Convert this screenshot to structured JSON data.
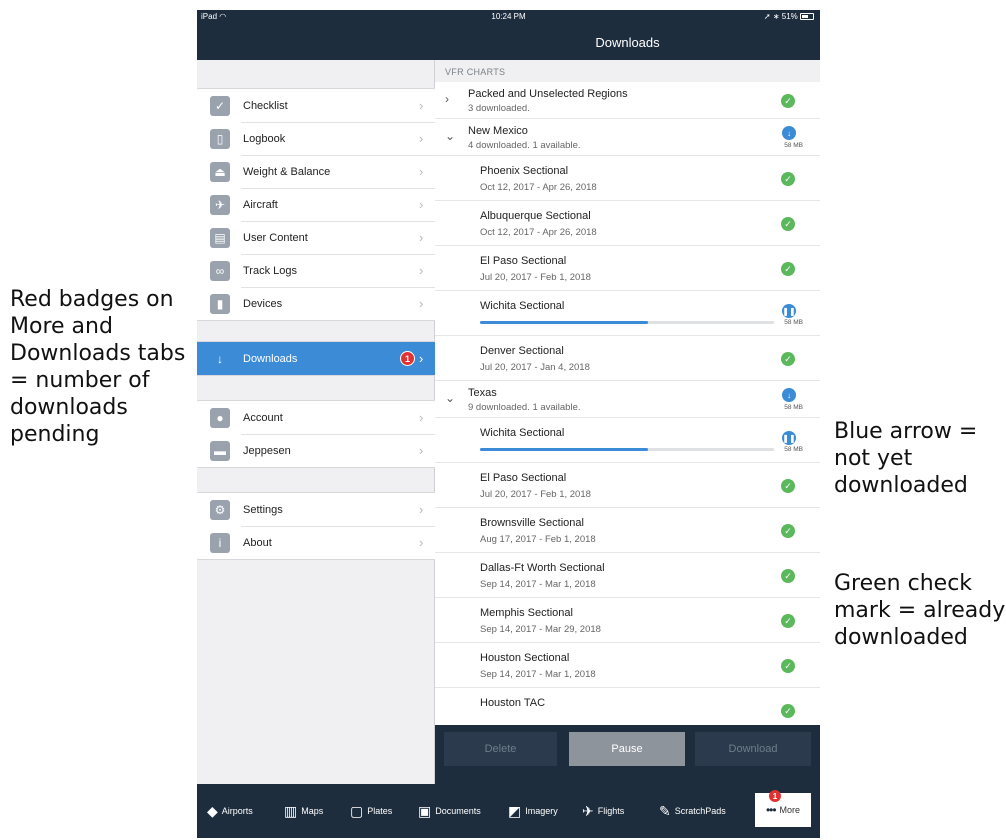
{
  "annotations": {
    "left": "Red badges on More and Downloads tabs = number of downloads pending",
    "blue_arrow": "Blue arrow = not yet downloaded",
    "green_check": "Green check mark = already downloaded"
  },
  "status_bar": {
    "device": "iPad",
    "time": "10:24 PM",
    "battery": "51%"
  },
  "nav": {
    "title": "Downloads"
  },
  "sidebar": {
    "group1": [
      {
        "label": "Checklist",
        "icon": "checklist-icon",
        "glyph": "✓"
      },
      {
        "label": "Logbook",
        "icon": "logbook-icon",
        "glyph": "▯"
      },
      {
        "label": "Weight & Balance",
        "icon": "weight-icon",
        "glyph": "⏏"
      },
      {
        "label": "Aircraft",
        "icon": "aircraft-icon",
        "glyph": "✈"
      },
      {
        "label": "User Content",
        "icon": "user-content-icon",
        "glyph": "▤"
      },
      {
        "label": "Track Logs",
        "icon": "track-logs-icon",
        "glyph": "∞"
      },
      {
        "label": "Devices",
        "icon": "devices-icon",
        "glyph": "▮"
      }
    ],
    "downloads": {
      "label": "Downloads",
      "icon": "download-arrow-icon",
      "glyph": "↓",
      "badge": "1"
    },
    "group3": [
      {
        "label": "Account",
        "icon": "account-icon",
        "glyph": "●"
      },
      {
        "label": "Jeppesen",
        "icon": "jeppesen-icon",
        "glyph": "▬"
      }
    ],
    "group4": [
      {
        "label": "Settings",
        "icon": "settings-icon",
        "glyph": "⚙"
      },
      {
        "label": "About",
        "icon": "about-icon",
        "glyph": "i"
      }
    ]
  },
  "content": {
    "section_header": "VFR CHARTS",
    "packed": {
      "title": "Packed and Unselected Regions",
      "sub": "3 downloaded."
    },
    "new_mexico": {
      "title": "New Mexico",
      "sub": "4 downloaded. 1 available.",
      "size": "58 MB",
      "charts": [
        {
          "title": "Phoenix Sectional",
          "sub": "Oct 12, 2017 - Apr 26, 2018"
        },
        {
          "title": "Albuquerque Sectional",
          "sub": "Oct 12, 2017 - Apr 26, 2018"
        },
        {
          "title": "El Paso Sectional",
          "sub": "Jul 20, 2017 - Feb 1, 2018"
        }
      ],
      "downloading": {
        "title": "Wichita Sectional",
        "size": "58 MB",
        "progress": 0.57
      },
      "charts_after": [
        {
          "title": "Denver Sectional",
          "sub": "Jul 20, 2017 - Jan 4, 2018"
        }
      ]
    },
    "texas": {
      "title": "Texas",
      "sub": "9 downloaded. 1 available.",
      "size": "58 MB",
      "downloading": {
        "title": "Wichita Sectional",
        "size": "58 MB",
        "progress": 0.57
      },
      "charts": [
        {
          "title": "El Paso Sectional",
          "sub": "Jul 20, 2017 - Feb 1, 2018"
        },
        {
          "title": "Brownsville Sectional",
          "sub": "Aug 17, 2017 - Feb 1, 2018"
        },
        {
          "title": "Dallas-Ft Worth Sectional",
          "sub": "Sep 14, 2017 - Mar 1, 2018"
        },
        {
          "title": "Memphis Sectional",
          "sub": "Sep 14, 2017 - Mar 29, 2018"
        },
        {
          "title": "Houston Sectional",
          "sub": "Sep 14, 2017 - Mar 1, 2018"
        },
        {
          "title": "Houston TAC",
          "sub": ""
        }
      ]
    }
  },
  "actions": {
    "delete": "Delete",
    "pause": "Pause",
    "download": "Download"
  },
  "tabs": [
    {
      "label": "Airports",
      "icon": "airports-icon",
      "glyph": "◆"
    },
    {
      "label": "Maps",
      "icon": "maps-icon",
      "glyph": "▥"
    },
    {
      "label": "Plates",
      "icon": "plates-icon",
      "glyph": "▢"
    },
    {
      "label": "Documents",
      "icon": "documents-icon",
      "glyph": "▣"
    },
    {
      "label": "Imagery",
      "icon": "imagery-icon",
      "glyph": "◩"
    },
    {
      "label": "Flights",
      "icon": "flights-icon",
      "glyph": "✈"
    },
    {
      "label": "ScratchPads",
      "icon": "scratchpads-icon",
      "glyph": "✎"
    }
  ],
  "more_tab": {
    "label": "More",
    "icon": "more-dots-icon",
    "glyph": "•••",
    "badge": "1"
  },
  "colors": {
    "navy": "#1e2d3e",
    "accent_blue": "#3b8bd6",
    "check_green": "#5cb85c",
    "badge_red": "#e23131"
  }
}
